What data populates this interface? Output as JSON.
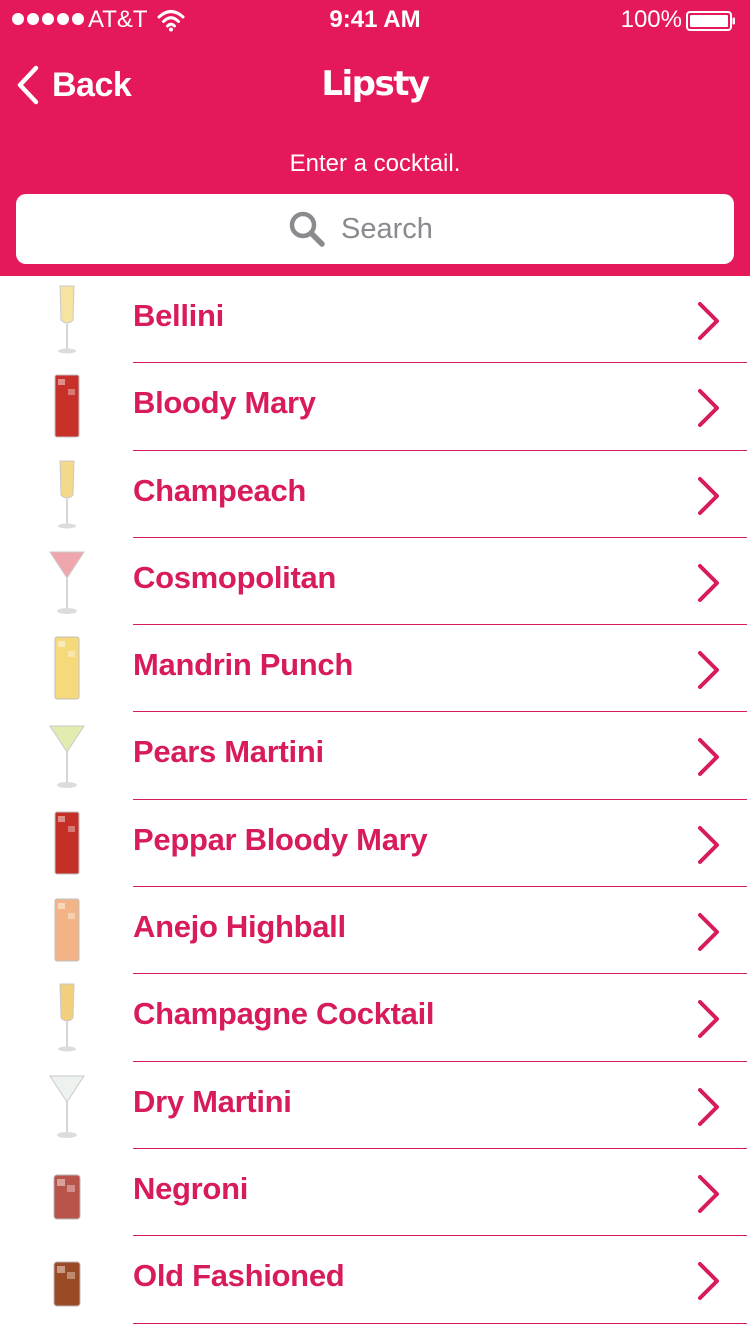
{
  "colors": {
    "brand": "#e5195a",
    "accent_text": "#d81b5c",
    "white": "#ffffff"
  },
  "status_bar": {
    "carrier": "AT&T",
    "time": "9:41 AM",
    "battery": "100%"
  },
  "nav": {
    "back_label": "Back",
    "app_title": "Lipsty"
  },
  "prompt": "Enter a cocktail.",
  "search": {
    "placeholder": "Search"
  },
  "cocktails": [
    {
      "name": "Bellini",
      "glass": "flute",
      "liquid": "#f6e3a0"
    },
    {
      "name": "Bloody Mary",
      "glass": "highball",
      "liquid": "#c8302a"
    },
    {
      "name": "Champeach",
      "glass": "flute",
      "liquid": "#f3da8a"
    },
    {
      "name": "Cosmopolitan",
      "glass": "martini",
      "liquid": "#f0a6ad"
    },
    {
      "name": "Mandrin Punch",
      "glass": "highball",
      "liquid": "#f6d97a"
    },
    {
      "name": "Pears Martini",
      "glass": "martini",
      "liquid": "#e2ecb0"
    },
    {
      "name": "Peppar Bloody Mary",
      "glass": "highball",
      "liquid": "#c43028"
    },
    {
      "name": "Anejo Highball",
      "glass": "highball",
      "liquid": "#f2b486"
    },
    {
      "name": "Champagne Cocktail",
      "glass": "flute",
      "liquid": "#f1cf7c"
    },
    {
      "name": "Dry Martini",
      "glass": "martini",
      "liquid": "#eef2ee"
    },
    {
      "name": "Negroni",
      "glass": "rocks",
      "liquid": "#b8544a"
    },
    {
      "name": "Old Fashioned",
      "glass": "rocks",
      "liquid": "#9a4a24"
    }
  ]
}
